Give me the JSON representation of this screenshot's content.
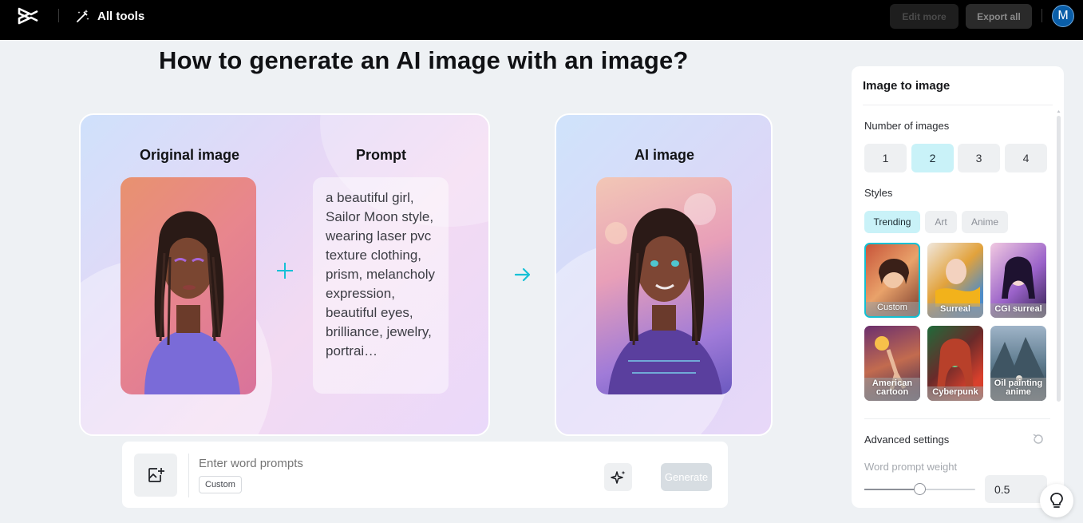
{
  "header": {
    "all_tools_label": "All tools",
    "edit_more_label": "Edit more",
    "export_all_label": "Export all",
    "avatar_initial": "M"
  },
  "main": {
    "title": "How to generate an AI image with an image?",
    "original_heading": "Original image",
    "prompt_heading": "Prompt",
    "ai_heading": "AI image",
    "prompt_text": "a beautiful girl, Sailor Moon style, wearing laser pvc texture clothing, prism, melancholy expression, beautiful eyes, brilliance, jewelry, portrai…"
  },
  "prompt_bar": {
    "placeholder": "Enter word prompts",
    "style_tag": "Custom",
    "generate_label": "Generate"
  },
  "panel": {
    "title": "Image to image",
    "number_label": "Number of images",
    "numbers": [
      "1",
      "2",
      "3",
      "4"
    ],
    "selected_number": "2",
    "styles_label": "Styles",
    "style_tabs": [
      "Trending",
      "Art",
      "Anime"
    ],
    "active_tab": "Trending",
    "styles": [
      {
        "label": "Custom",
        "selected": true
      },
      {
        "label": "Surreal",
        "selected": false
      },
      {
        "label": "CGI surreal",
        "selected": false
      },
      {
        "label": "American cartoon",
        "selected": false
      },
      {
        "label": "Cyberpunk",
        "selected": false
      },
      {
        "label": "Oil painting anime",
        "selected": false
      }
    ],
    "advanced_label": "Advanced settings",
    "weight_label": "Word prompt weight",
    "weight_value": "0.5",
    "weight_fraction": 0.5
  },
  "colors": {
    "accent": "#13c0d2",
    "active_bg": "#c9f2f8",
    "topbar": "#000000"
  },
  "icons": [
    "capcut-logo-icon",
    "magic-wand-icon",
    "plus-icon",
    "arrow-right-icon",
    "image-upload-icon",
    "sparkle-icon",
    "reset-icon",
    "lightbulb-icon"
  ]
}
